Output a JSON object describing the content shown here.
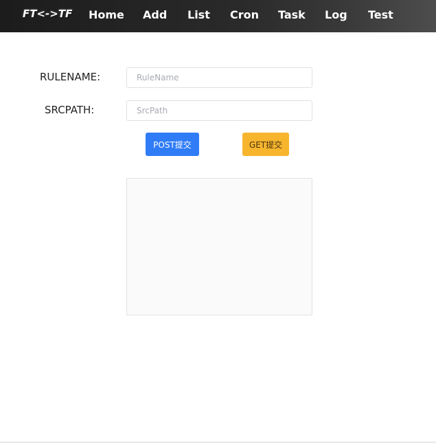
{
  "navbar": {
    "brand": "FT<->TF",
    "items": [
      {
        "label": "Home"
      },
      {
        "label": "Add"
      },
      {
        "label": "List"
      },
      {
        "label": "Cron"
      },
      {
        "label": "Task"
      },
      {
        "label": "Log"
      },
      {
        "label": "Test"
      }
    ]
  },
  "form": {
    "rulename": {
      "label": "RULENAME:",
      "placeholder": "RuleName",
      "value": ""
    },
    "srcpath": {
      "label": "SRCPATH:",
      "placeholder": "SrcPath",
      "value": ""
    }
  },
  "buttons": {
    "post_label": "POST提交",
    "get_label": "GET提交"
  },
  "colors": {
    "post_button": "#2f7cf6",
    "get_button": "#f7b52e",
    "navbar": "#1c1c1c"
  }
}
